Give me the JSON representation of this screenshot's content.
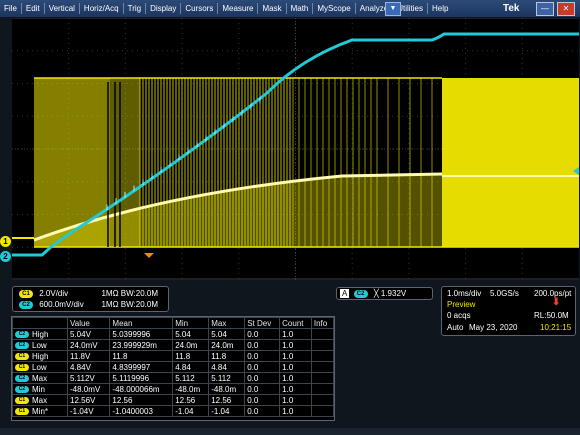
{
  "menu": {
    "items": [
      "File",
      "Edit",
      "Vertical",
      "Horiz/Acq",
      "Trig",
      "Display",
      "Cursors",
      "Measure",
      "Mask",
      "Math",
      "MyScope",
      "Analyze",
      "Utilities",
      "Help"
    ],
    "dropdown_glyph": "▼",
    "brand": "Tek",
    "minimize_glyph": "—",
    "close_glyph": "✕"
  },
  "markers": {
    "ch1": "1",
    "ch2": "2"
  },
  "channels": [
    {
      "id": "C1",
      "scale": "2.0V/div",
      "coupling": "1MΩ",
      "bw": "B",
      "bw_value": "W:20.0M"
    },
    {
      "id": "C2",
      "scale": "600.0mV/div",
      "coupling": "1MΩ",
      "bw": "B",
      "bw_value": "W:20.0M"
    }
  ],
  "trigger": {
    "source": "A",
    "channel": "C2",
    "slope_glyph": "╳",
    "level": "1.932V"
  },
  "acquisition": {
    "timebase": "1.0ms/div",
    "sample_rate": "5.0GS/s",
    "resolution": "200.0ps/pt",
    "mode": "Preview",
    "acqs": "0 acqs",
    "record_length": "RL:50.0M",
    "trigger_mode": "Auto",
    "date": "May 23, 2020",
    "time": "10:21:15"
  },
  "measurements": {
    "headers": [
      "",
      "Value",
      "Mean",
      "Min",
      "Max",
      "St Dev",
      "Count",
      "Info"
    ],
    "rows": [
      {
        "src": "C2",
        "name": "High",
        "value": "5.04V",
        "mean": "5.0399996",
        "min": "5.04",
        "max": "5.04",
        "stdev": "0.0",
        "count": "1.0",
        "info": ""
      },
      {
        "src": "C2",
        "name": "Low",
        "value": "24.0mV",
        "mean": "23.999929m",
        "min": "24.0m",
        "max": "24.0m",
        "stdev": "0.0",
        "count": "1.0",
        "info": ""
      },
      {
        "src": "C1",
        "name": "High",
        "value": "11.8V",
        "mean": "11.8",
        "min": "11.8",
        "max": "11.8",
        "stdev": "0.0",
        "count": "1.0",
        "info": ""
      },
      {
        "src": "C1",
        "name": "Low",
        "value": "4.84V",
        "mean": "4.8399997",
        "min": "4.84",
        "max": "4.84",
        "stdev": "0.0",
        "count": "1.0",
        "info": ""
      },
      {
        "src": "C2",
        "name": "Max",
        "value": "5.112V",
        "mean": "5.1119996",
        "min": "5.112",
        "max": "5.112",
        "stdev": "0.0",
        "count": "1.0",
        "info": ""
      },
      {
        "src": "C2",
        "name": "Min",
        "value": "-48.0mV",
        "mean": "-48.000066m",
        "min": "-48.0m",
        "max": "-48.0m",
        "stdev": "0.0",
        "count": "1.0",
        "info": ""
      },
      {
        "src": "C1",
        "name": "Max",
        "value": "12.56V",
        "mean": "12.56",
        "min": "12.56",
        "max": "12.56",
        "stdev": "0.0",
        "count": "1.0",
        "info": ""
      },
      {
        "src": "C1",
        "name": "Min*",
        "value": "-1.04V",
        "mean": "-1.0400003",
        "min": "-1.04",
        "max": "-1.04",
        "stdev": "0.0",
        "count": "1.0",
        "info": ""
      }
    ]
  },
  "colors": {
    "ch1": "#f1e800",
    "ch2": "#22c9d6",
    "preview": "#f1e800",
    "time": "#f1e800"
  }
}
